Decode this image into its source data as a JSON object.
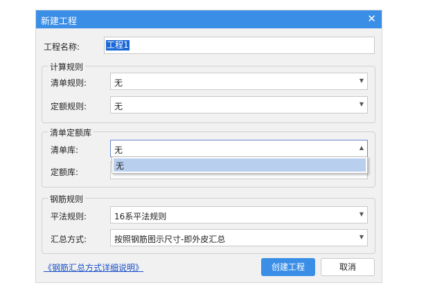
{
  "dialog": {
    "title": "新建工程",
    "close_icon": "close-icon"
  },
  "project_name": {
    "label": "工程名称:",
    "value": "工程1"
  },
  "calc_rules": {
    "legend": "计算规则",
    "bill_rule_label": "清单规则:",
    "bill_rule_value": "无",
    "quota_rule_label": "定额规则:",
    "quota_rule_value": "无"
  },
  "bill_quota_library": {
    "legend": "清单定额库",
    "bill_lib_label": "清单库:",
    "bill_lib_value": "无",
    "quota_lib_label": "定额库:",
    "dropdown_options": [
      "无"
    ]
  },
  "rebar_rules": {
    "legend": "钢筋规则",
    "flat_rule_label": "平法规则:",
    "flat_rule_value": "16系平法规则",
    "summary_label": "汇总方式:",
    "summary_value": "按照钢筋图示尺寸-即外皮汇总"
  },
  "footer": {
    "help_link": "《钢筋汇总方式详细说明》",
    "create_button": "创建工程",
    "cancel_button": "取消"
  },
  "colors": {
    "accent": "#3a8ee6",
    "selection": "#b8cfee",
    "link": "#1a4fc8"
  }
}
